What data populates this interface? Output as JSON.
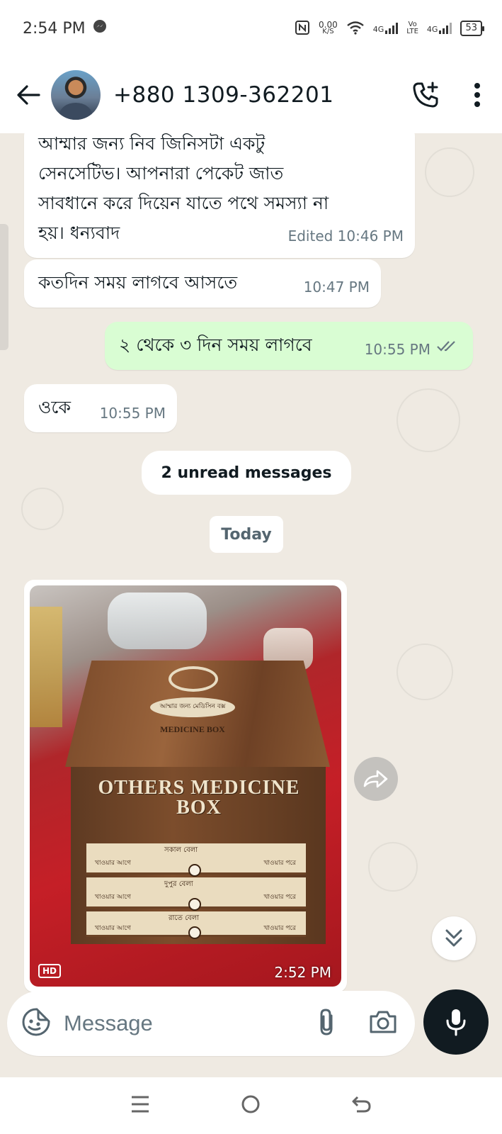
{
  "status_bar": {
    "time": "2:54 PM",
    "net_speed_value": "0.00",
    "net_speed_unit": "K/S",
    "sim1_label": "4G",
    "volte_label_top": "Vo",
    "volte_label_bottom": "LTE",
    "sim2_label": "4G",
    "battery": "53"
  },
  "header": {
    "contact_name": "+880 1309-362201"
  },
  "messages": [
    {
      "direction": "incoming",
      "text": "আম্মার জন্য নিব জিনিসটা একটু\nসেনসেটিভ।  আপনারা পেকেট জাত\nসাবধানে করে দিয়েন যাতে পথে সমস্যা না\nহয়। ধন্যবাদ",
      "time": "Edited 10:46 PM"
    },
    {
      "direction": "incoming",
      "text": "কতদিন সময় লাগবে আসতে",
      "time": "10:47 PM"
    },
    {
      "direction": "outgoing",
      "text": "২ থেকে ৩ দিন সময় লাগবে",
      "time": "10:55 PM",
      "status": "read"
    },
    {
      "direction": "incoming",
      "text": "ওকে",
      "time": "10:55 PM"
    }
  ],
  "unread_banner": "2 unread messages",
  "date_chip": "Today",
  "photo_message": {
    "direction": "incoming",
    "badge": "HD",
    "time": "2:52 PM",
    "product_plaque": "আম্মার জন্য মেডিসিন বক্স",
    "lid_text": "MEDICINE BOX",
    "front_text_line1": "OTHERS MEDICINE",
    "front_text_line2": "BOX",
    "drawers": [
      {
        "title": "সকাল বেলা",
        "left": "খাওয়ার আগে",
        "right": "খাওয়ার পরে"
      },
      {
        "title": "দুপুর বেলা",
        "left": "খাওয়ার আগে",
        "right": "খাওয়ার পরে"
      },
      {
        "title": "রাতে বেলা",
        "left": "খাওয়ার আগে",
        "right": "খাওয়ার পরে"
      }
    ]
  },
  "composer": {
    "placeholder": "Message"
  },
  "colors": {
    "chat_bg": "#efeae2",
    "outgoing_bubble": "#d9fdd3",
    "incoming_bubble": "#ffffff",
    "read_ticks": "#53bdeb",
    "mic_button": "#111b21"
  },
  "icons": {
    "back": "arrow-left-icon",
    "call": "add-call-icon",
    "menu": "more-vert-icon",
    "emoji": "sticker-icon",
    "attach": "paperclip-icon",
    "camera": "camera-icon",
    "mic": "mic-icon",
    "forward": "forward-icon",
    "scroll_down": "double-chevron-down-icon"
  }
}
